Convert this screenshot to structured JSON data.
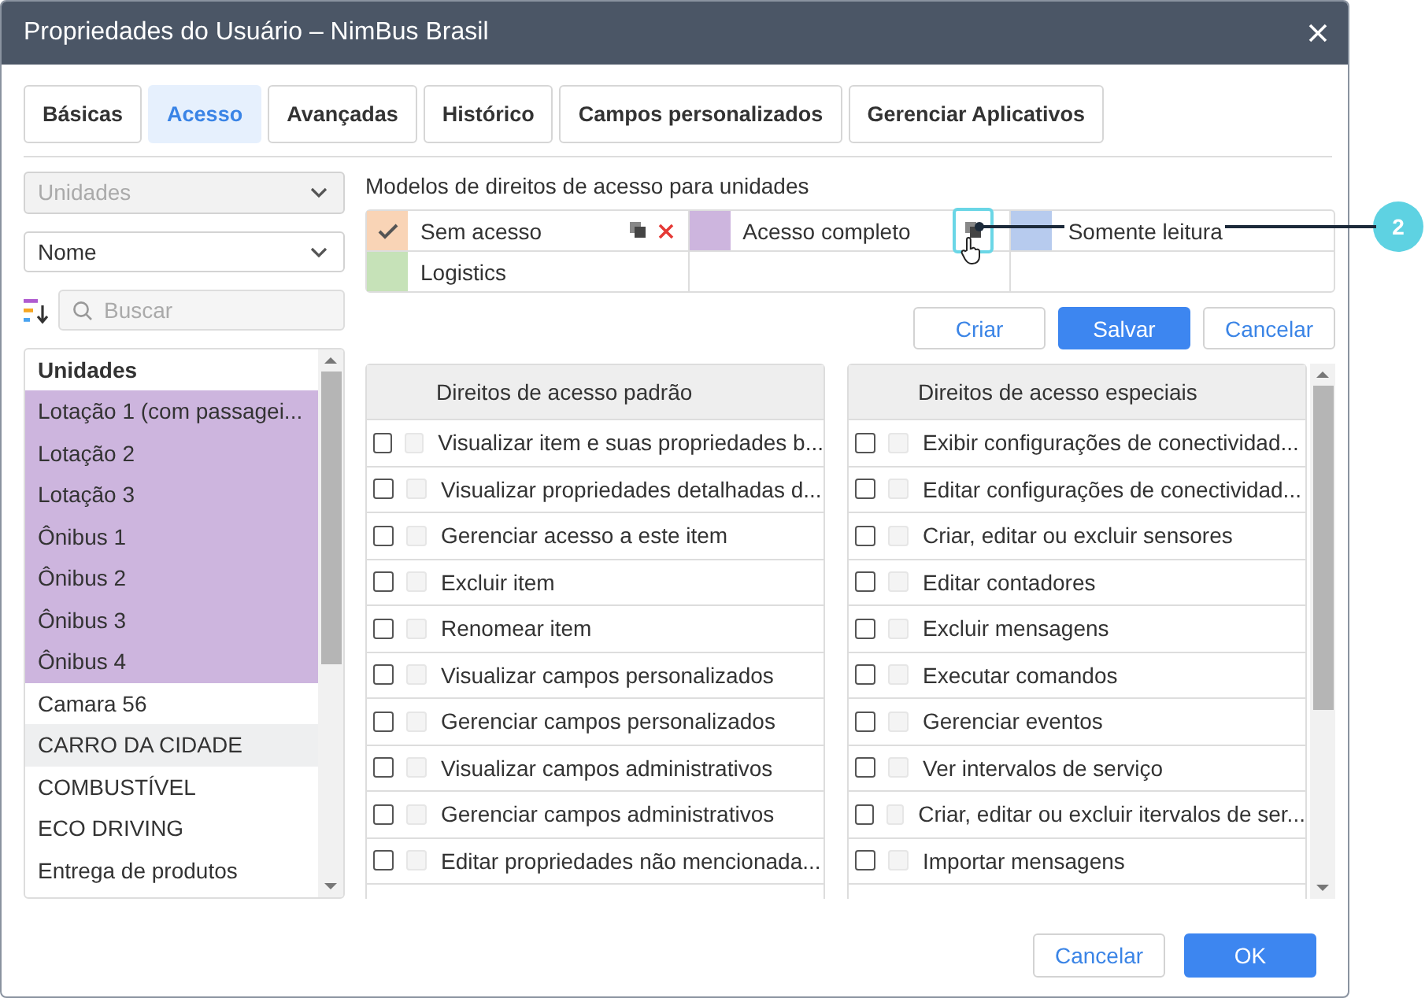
{
  "window": {
    "title": "Propriedades do Usuário – NimBus Brasil"
  },
  "tabs": [
    {
      "label": "Básicas",
      "selected": false
    },
    {
      "label": "Acesso",
      "selected": true
    },
    {
      "label": "Avançadas",
      "selected": false
    },
    {
      "label": "Histórico",
      "selected": false
    },
    {
      "label": "Campos personalizados",
      "selected": false
    },
    {
      "label": "Gerenciar Aplicativos",
      "selected": false
    }
  ],
  "filters": {
    "type_select": {
      "value": "Unidades",
      "disabled": true
    },
    "sort_select": {
      "value": "Nome",
      "disabled": false
    },
    "search": {
      "placeholder": "Buscar"
    }
  },
  "units": {
    "header": "Unidades",
    "items": [
      {
        "label": "Lotação 1 (com passagei...",
        "selected": true,
        "highlighted": false
      },
      {
        "label": "Lotação 2",
        "selected": true,
        "highlighted": false
      },
      {
        "label": "Lotação 3",
        "selected": true,
        "highlighted": false
      },
      {
        "label": "Ônibus 1",
        "selected": true,
        "highlighted": false
      },
      {
        "label": "Ônibus 2",
        "selected": true,
        "highlighted": false
      },
      {
        "label": "Ônibus 3",
        "selected": true,
        "highlighted": false
      },
      {
        "label": "Ônibus 4",
        "selected": true,
        "highlighted": false
      },
      {
        "label": "Camara 56",
        "selected": false,
        "highlighted": false
      },
      {
        "label": "CARRO DA CIDADE",
        "selected": false,
        "highlighted": true
      },
      {
        "label": "COMBUSTÍVEL",
        "selected": false,
        "highlighted": false
      },
      {
        "label": "ECO DRIVING",
        "selected": false,
        "highlighted": false
      },
      {
        "label": "Entrega de produtos",
        "selected": false,
        "highlighted": false
      }
    ]
  },
  "templates": {
    "title": "Modelos de direitos de acesso para unidades",
    "items": [
      {
        "name": "Sem acesso",
        "color": "#f9d4b6",
        "selected": true,
        "copy_icon": true,
        "delete_icon": true,
        "copy_highlighted": false
      },
      {
        "name": "Acesso completo",
        "color": "#cdb5de",
        "selected": false,
        "copy_icon": true,
        "delete_icon": false,
        "copy_highlighted": true
      },
      {
        "name": "Somente leitura",
        "color": "#b7cbee",
        "selected": false,
        "copy_icon": false,
        "delete_icon": false,
        "copy_highlighted": false
      },
      {
        "name": "Logistics",
        "color": "#c6e2b8",
        "selected": false,
        "copy_icon": false,
        "delete_icon": false,
        "copy_highlighted": false
      }
    ]
  },
  "template_buttons": [
    {
      "label": "Criar",
      "kind": "outline"
    },
    {
      "label": "Salvar",
      "kind": "primary"
    },
    {
      "label": "Cancelar",
      "kind": "outline"
    }
  ],
  "rights": [
    {
      "title": "Direitos de acesso padrão",
      "items": [
        {
          "label": "Visualizar item e suas propriedades b...",
          "checked": false,
          "second_checked": false,
          "second_disabled": true
        },
        {
          "label": "Visualizar propriedades detalhadas d...",
          "checked": false,
          "second_checked": false,
          "second_disabled": true
        },
        {
          "label": "Gerenciar acesso a este item",
          "checked": false,
          "second_checked": false,
          "second_disabled": true
        },
        {
          "label": "Excluir item",
          "checked": false,
          "second_checked": false,
          "second_disabled": true
        },
        {
          "label": "Renomear item",
          "checked": false,
          "second_checked": false,
          "second_disabled": true
        },
        {
          "label": "Visualizar campos personalizados",
          "checked": false,
          "second_checked": false,
          "second_disabled": true
        },
        {
          "label": "Gerenciar campos personalizados",
          "checked": false,
          "second_checked": false,
          "second_disabled": true
        },
        {
          "label": "Visualizar campos administrativos",
          "checked": false,
          "second_checked": false,
          "second_disabled": true
        },
        {
          "label": "Gerenciar campos administrativos",
          "checked": false,
          "second_checked": false,
          "second_disabled": true
        },
        {
          "label": "Editar propriedades não mencionada...",
          "checked": false,
          "second_checked": false,
          "second_disabled": true
        }
      ]
    },
    {
      "title": "Direitos de acesso especiais",
      "items": [
        {
          "label": "Exibir configurações de conectividad...",
          "checked": false,
          "second_checked": false,
          "second_disabled": true
        },
        {
          "label": "Editar configurações de conectividad...",
          "checked": false,
          "second_checked": false,
          "second_disabled": true
        },
        {
          "label": "Criar, editar ou excluir sensores",
          "checked": false,
          "second_checked": false,
          "second_disabled": true
        },
        {
          "label": "Editar contadores",
          "checked": false,
          "second_checked": false,
          "second_disabled": true
        },
        {
          "label": "Excluir mensagens",
          "checked": false,
          "second_checked": false,
          "second_disabled": true
        },
        {
          "label": "Executar comandos",
          "checked": false,
          "second_checked": false,
          "second_disabled": true
        },
        {
          "label": "Gerenciar eventos",
          "checked": false,
          "second_checked": false,
          "second_disabled": true
        },
        {
          "label": "Ver intervalos de serviço",
          "checked": false,
          "second_checked": false,
          "second_disabled": true
        },
        {
          "label": "Criar, editar ou excluir itervalos de ser...",
          "checked": false,
          "second_checked": false,
          "second_disabled": true
        },
        {
          "label": "Importar mensagens",
          "checked": false,
          "second_checked": false,
          "second_disabled": true
        }
      ]
    }
  ],
  "footer_buttons": [
    {
      "label": "Cancelar",
      "kind": "outline"
    },
    {
      "label": "OK",
      "kind": "primary"
    }
  ],
  "callout": {
    "number": "2"
  }
}
